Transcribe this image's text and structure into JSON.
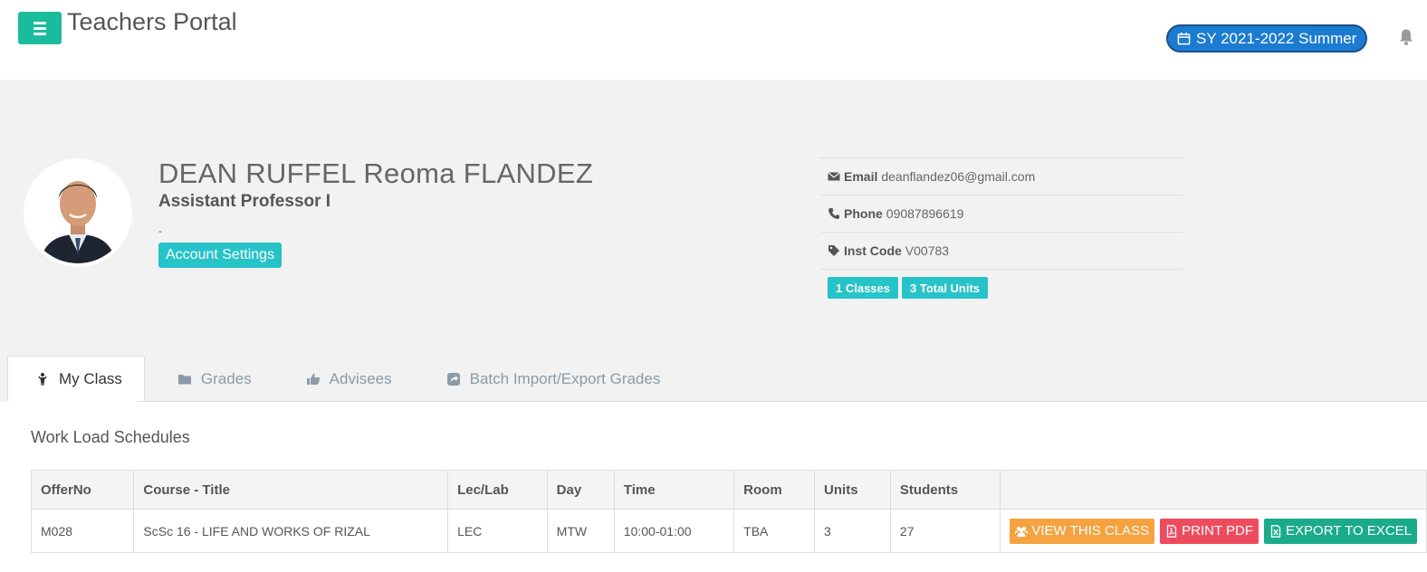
{
  "app": {
    "title": "Teachers Portal",
    "school_year": "SY 2021-2022 Summer"
  },
  "profile": {
    "name": "DEAN RUFFEL Reoma FLANDEZ",
    "position": "Assistant Professor I",
    "dash": "-",
    "account_settings_label": "Account Settings",
    "email_label": "Email",
    "email": "deanflandez06@gmail.com",
    "phone_label": "Phone",
    "phone": "09087896619",
    "inst_code_label": "Inst Code",
    "inst_code": "V00783",
    "classes_badge": "1 Classes",
    "units_badge": "3 Total Units"
  },
  "tabs": [
    {
      "label": "My Class",
      "icon": "person-icon",
      "active": true
    },
    {
      "label": "Grades",
      "icon": "folder-icon",
      "active": false
    },
    {
      "label": "Advisees",
      "icon": "thumbs-up-icon",
      "active": false
    },
    {
      "label": "Batch Import/Export Grades",
      "icon": "share-icon",
      "active": false
    }
  ],
  "workload": {
    "title": "Work Load Schedules",
    "columns": [
      "OfferNo",
      "Course - Title",
      "Lec/Lab",
      "Day",
      "Time",
      "Room",
      "Units",
      "Students",
      ""
    ],
    "rows": [
      {
        "offer_no": "M028",
        "course": "ScSc 16 - LIFE AND WORKS OF RIZAL",
        "lec_lab": "LEC",
        "day": "MTW",
        "time": "10:00-01:00",
        "room": "TBA",
        "units": "3",
        "students": "27"
      }
    ],
    "actions": {
      "view": "VIEW THIS CLASS",
      "pdf": "PRINT PDF",
      "excel": "EXPORT TO EXCEL"
    }
  },
  "colors": {
    "accent": "#1abc9c",
    "badge": "#26c3c9",
    "sy_badge": "#1b7bd0",
    "view_btn": "#f4a340",
    "pdf_btn": "#ee4b5f",
    "excel_btn": "#1aab8a"
  }
}
